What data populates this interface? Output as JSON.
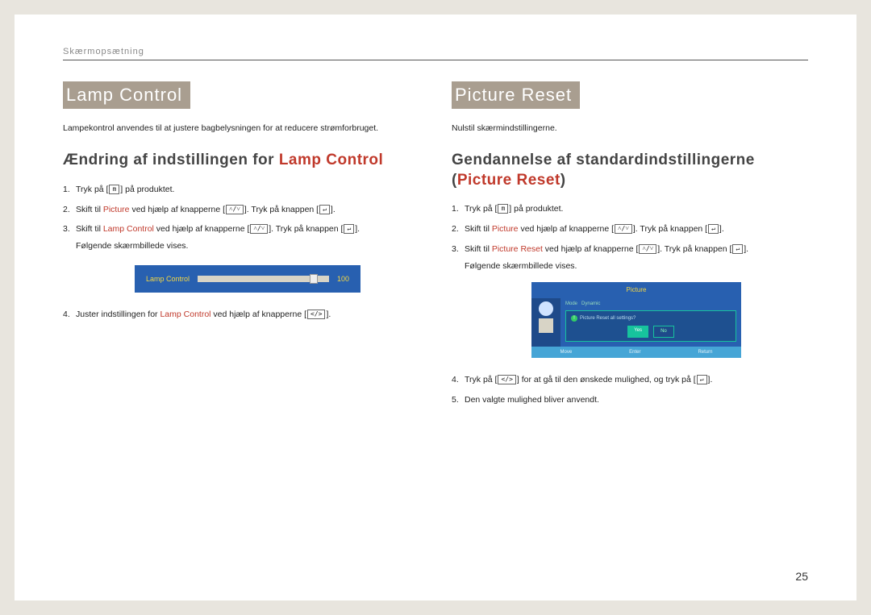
{
  "header": "Skærmopsætning",
  "pageNumber": "25",
  "left": {
    "title": "Lamp Control",
    "intro": "Lampekontrol anvendes til at justere bagbelysningen for at reducere strømforbruget.",
    "subhead_prefix": "Ændring af indstillingen for ",
    "subhead_hl": "Lamp Control",
    "steps": {
      "s1_a": "Tryk på [",
      "s1_b": "] på produktet.",
      "s2_a": "Skift til ",
      "s2_hl": "Picture",
      "s2_b": " ved hjælp af knapperne [",
      "s2_c": "]. Tryk på knappen [",
      "s2_d": "].",
      "s3_a": "Skift til ",
      "s3_hl": "Lamp Control",
      "s3_b": " ved hjælp af knapperne [",
      "s3_c": "]. Tryk på knappen [",
      "s3_d": "].",
      "s3_note": "Følgende skærmbillede vises.",
      "s4_a": "Juster indstillingen for ",
      "s4_hl": "Lamp Control",
      "s4_b": " ved hjælp af knapperne [",
      "s4_c": "]."
    },
    "mock": {
      "label": "Lamp Control",
      "value": "100"
    }
  },
  "right": {
    "title": "Picture Reset",
    "intro": "Nulstil skærmindstillingerne.",
    "subhead_line1": "Gendannelse af standardindstillingerne",
    "subhead_paren_open": "(",
    "subhead_hl": "Picture Reset",
    "subhead_paren_close": ")",
    "steps": {
      "s1_a": "Tryk på [",
      "s1_b": "] på produktet.",
      "s2_a": "Skift til ",
      "s2_hl": "Picture",
      "s2_b": " ved hjælp af knapperne [",
      "s2_c": "]. Tryk på knappen [",
      "s2_d": "].",
      "s3_a": "Skift til ",
      "s3_hl": "Picture Reset",
      "s3_b": " ved hjælp af knapperne [",
      "s3_c": "]. Tryk på knappen [",
      "s3_d": "].",
      "s3_note": "Følgende skærmbillede vises.",
      "s4_a": "Tryk på [",
      "s4_b": "] for at gå til den ønskede mulighed, og tryk på [",
      "s4_c": "].",
      "s5": "Den valgte mulighed bliver anvendt."
    },
    "mock": {
      "title": "Picture",
      "row1": "Mode",
      "row1v": "Dynamic",
      "question": "Picture Reset all settings?",
      "yes": "Yes",
      "no": "No",
      "foot1": "Move",
      "foot2": "Enter",
      "foot3": "Return"
    }
  },
  "icons": {
    "menu": "m",
    "updown": "˄/˅",
    "enter": "↵",
    "leftright": "</>"
  }
}
